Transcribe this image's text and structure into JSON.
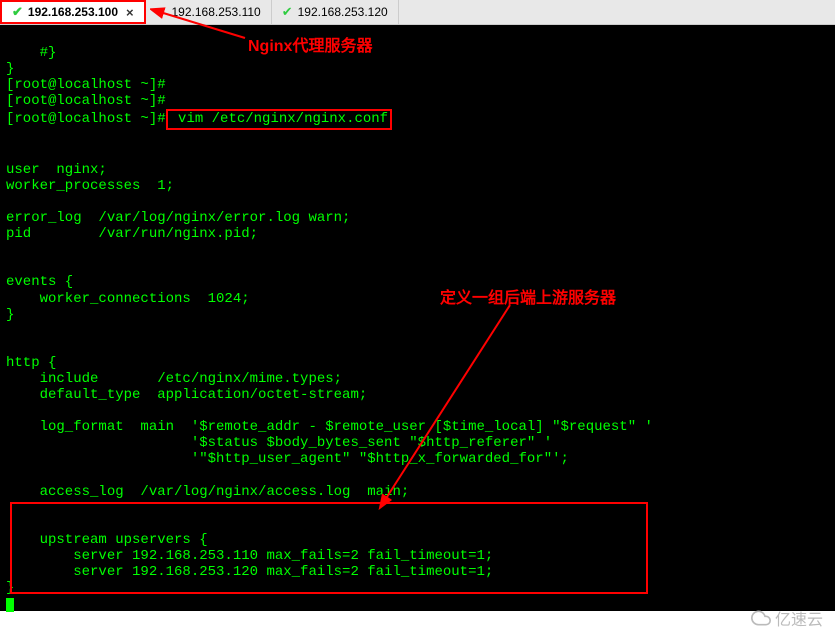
{
  "tabs": [
    {
      "ip": "192.168.253.100",
      "active": true
    },
    {
      "ip": "192.168.253.110",
      "active": false
    },
    {
      "ip": "192.168.253.120",
      "active": false
    }
  ],
  "annotations": {
    "proxy_label": "Nginx代理服务器",
    "upstream_label": "定义一组后端上游服务器"
  },
  "terminal": {
    "hash_line": "    #}",
    "prompt1": "[root@localhost ~]#",
    "prompt2": "[root@localhost ~]#",
    "prompt3_prefix": "[root@localhost ~]#",
    "command": " vim /etc/nginx/nginx.conf",
    "blank": "",
    "l_user": "user  nginx;",
    "l_wp": "worker_processes  1;",
    "l_errlog": "error_log  /var/log/nginx/error.log warn;",
    "l_pid": "pid        /var/run/nginx.pid;",
    "l_events_open": "events {",
    "l_wc": "    worker_connections  1024;",
    "l_events_close": "}",
    "l_http_open": "http {",
    "l_include": "    include       /etc/nginx/mime.types;",
    "l_deftype": "    default_type  application/octet-stream;",
    "l_logfmt1": "    log_format  main  '$remote_addr - $remote_user [$time_local] \"$request\" '",
    "l_logfmt2": "                      '$status $body_bytes_sent \"$http_referer\" '",
    "l_logfmt3": "                      '\"$http_user_agent\" \"$http_x_forwarded_for\"';",
    "l_acclog": "    access_log  /var/log/nginx/access.log  main;",
    "l_upstream_open": "    upstream upservers {",
    "l_srv1": "        server 192.168.253.110 max_fails=2 fail_timeout=1;",
    "l_srv2": "        server 192.168.253.120 max_fails=2 fail_timeout=1;"
  },
  "watermark": {
    "text": "亿速云"
  }
}
